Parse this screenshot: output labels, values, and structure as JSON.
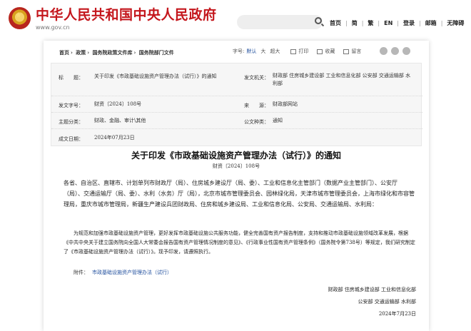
{
  "header": {
    "site_title": "中华人民共和国中央人民政府",
    "site_url": "www.gov.cn",
    "nav": [
      "首页",
      "简",
      "繁",
      "EN",
      "登录",
      "邮箱",
      "无障碍"
    ]
  },
  "breadcrumb": [
    "首页",
    "政策",
    "国务院政策文件库",
    "国务院部门文件"
  ],
  "tools": {
    "font_label": "字号:",
    "font_default": "默认",
    "font_large": "大",
    "font_xlarge": "超大",
    "print": "打印",
    "favorite": "收藏",
    "keep": "留言"
  },
  "meta": {
    "title_key": "标　　题：",
    "title_val": "关于印发《市政基础设施资产管理办法（试行）》的通知",
    "issuer_key": "发文机关：",
    "issuer_val": "财政部 住房城乡建设部 工业和信息化部 公安部 交通运输部 水利部",
    "docno_key": "发文字号：",
    "docno_val": "财资〔2024〕108号",
    "source_key": "来　　源：",
    "source_val": "财政部网站",
    "topic_key": "主题分类：",
    "topic_val": "财政、金融、审计\\其他",
    "type_key": "公文种类：",
    "type_val": "通知",
    "date_key": "成文日期：",
    "date_val": "2024年07月23日"
  },
  "document": {
    "title": "关于印发《市政基础设施资产管理办法（试行）》的通知",
    "number": "财资〔2024〕108号",
    "addressees": "各省、自治区、直辖市、计划单列市财政厅（局）、住房城乡建设厅（局、委）、工业和信息化主管部门（数据产业主管部门）、公安厅（局）、交通运输厅（局、委）、水利（水务）厅（局），北京市城市管理委员会、园林绿化局，天津市城市管理委员会，上海市绿化和市容管理局，重庆市城市管理局，新疆生产建设兵团财政局、住房和城乡建设局、工业和信息化局、公安局、交通运输局、水利局：",
    "body": "为规范和加强市政基础设施资产管理，更好发挥市政基础设施公共服务功能，健全完善国有资产报告制度，支持和推动市政基础设施领域改革发展，根据《中共中央关于建立国务院向全国人大常委会报告国有资产管理情况制度的意见》、《行政事业性国有资产管理条例》（国务院令第738号）等规定，我们研究制定了《市政基础设施资产管理办法（试行）》。现予印发，请遵照执行。",
    "attachment_label": "附件：",
    "attachment_link": "市政基础设施资产管理办法（试行）",
    "sign_line1": "财政部 住房城乡建设部 工业和信息化部",
    "sign_line2": "公安部 交通运输部 水利部",
    "sign_date": "2024年7月23日"
  }
}
